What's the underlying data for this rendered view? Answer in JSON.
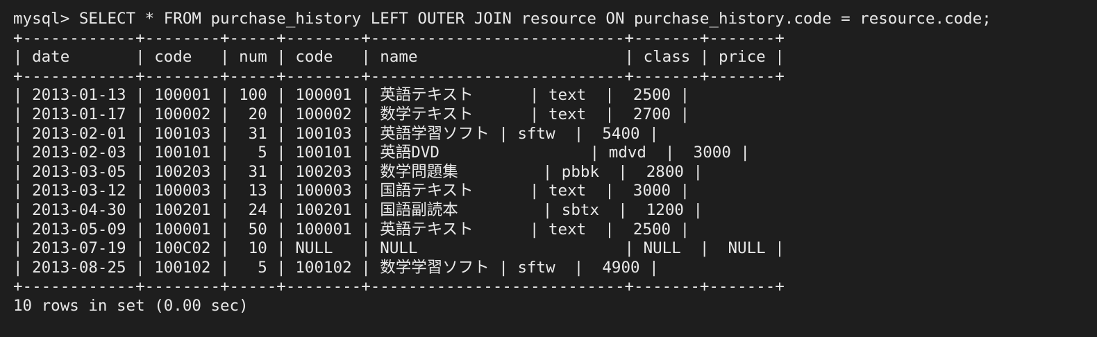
{
  "terminal": {
    "prompt": "mysql> ",
    "command": "SELECT * FROM purchase_history LEFT OUTER JOIN resource ON purchase_history.code = resource.code;",
    "result": {
      "border": "+------------+--------+-----+--------+---------------------------+-------+-------+",
      "header": "| date       | code   | num | code   | name                      | class | price |",
      "rows": [
        "| 2013-01-13 | 100001 | 100 | 100001 | 英語テキスト      | text  |  2500 |",
        "| 2013-01-17 | 100002 |  20 | 100002 | 数学テキスト      | text  |  2700 |",
        "| 2013-02-01 | 100103 |  31 | 100103 | 英語学習ソフト | sftw  |  5400 |",
        "| 2013-02-03 | 100101 |   5 | 100101 | 英語DVD                | mdvd  |  3000 |",
        "| 2013-03-05 | 100203 |  31 | 100203 | 数学問題集         | pbbk  |  2800 |",
        "| 2013-03-12 | 100003 |  13 | 100003 | 国語テキスト      | text  |  3000 |",
        "| 2013-04-30 | 100201 |  24 | 100201 | 国語副読本         | sbtx  |  1200 |",
        "| 2013-05-09 | 100001 |  50 | 100001 | 英語テキスト      | text  |  2500 |",
        "| 2013-07-19 | 100C02 |  10 | NULL   | NULL                      | NULL  |  NULL |",
        "| 2013-08-25 | 100102 |   5 | 100102 | 数学学習ソフト | sftw  |  4900 |"
      ],
      "footer": "10 rows in set (0.00 sec)"
    }
  },
  "colors": {
    "background": "#1e1e1e",
    "text": "#e8e8e8"
  }
}
